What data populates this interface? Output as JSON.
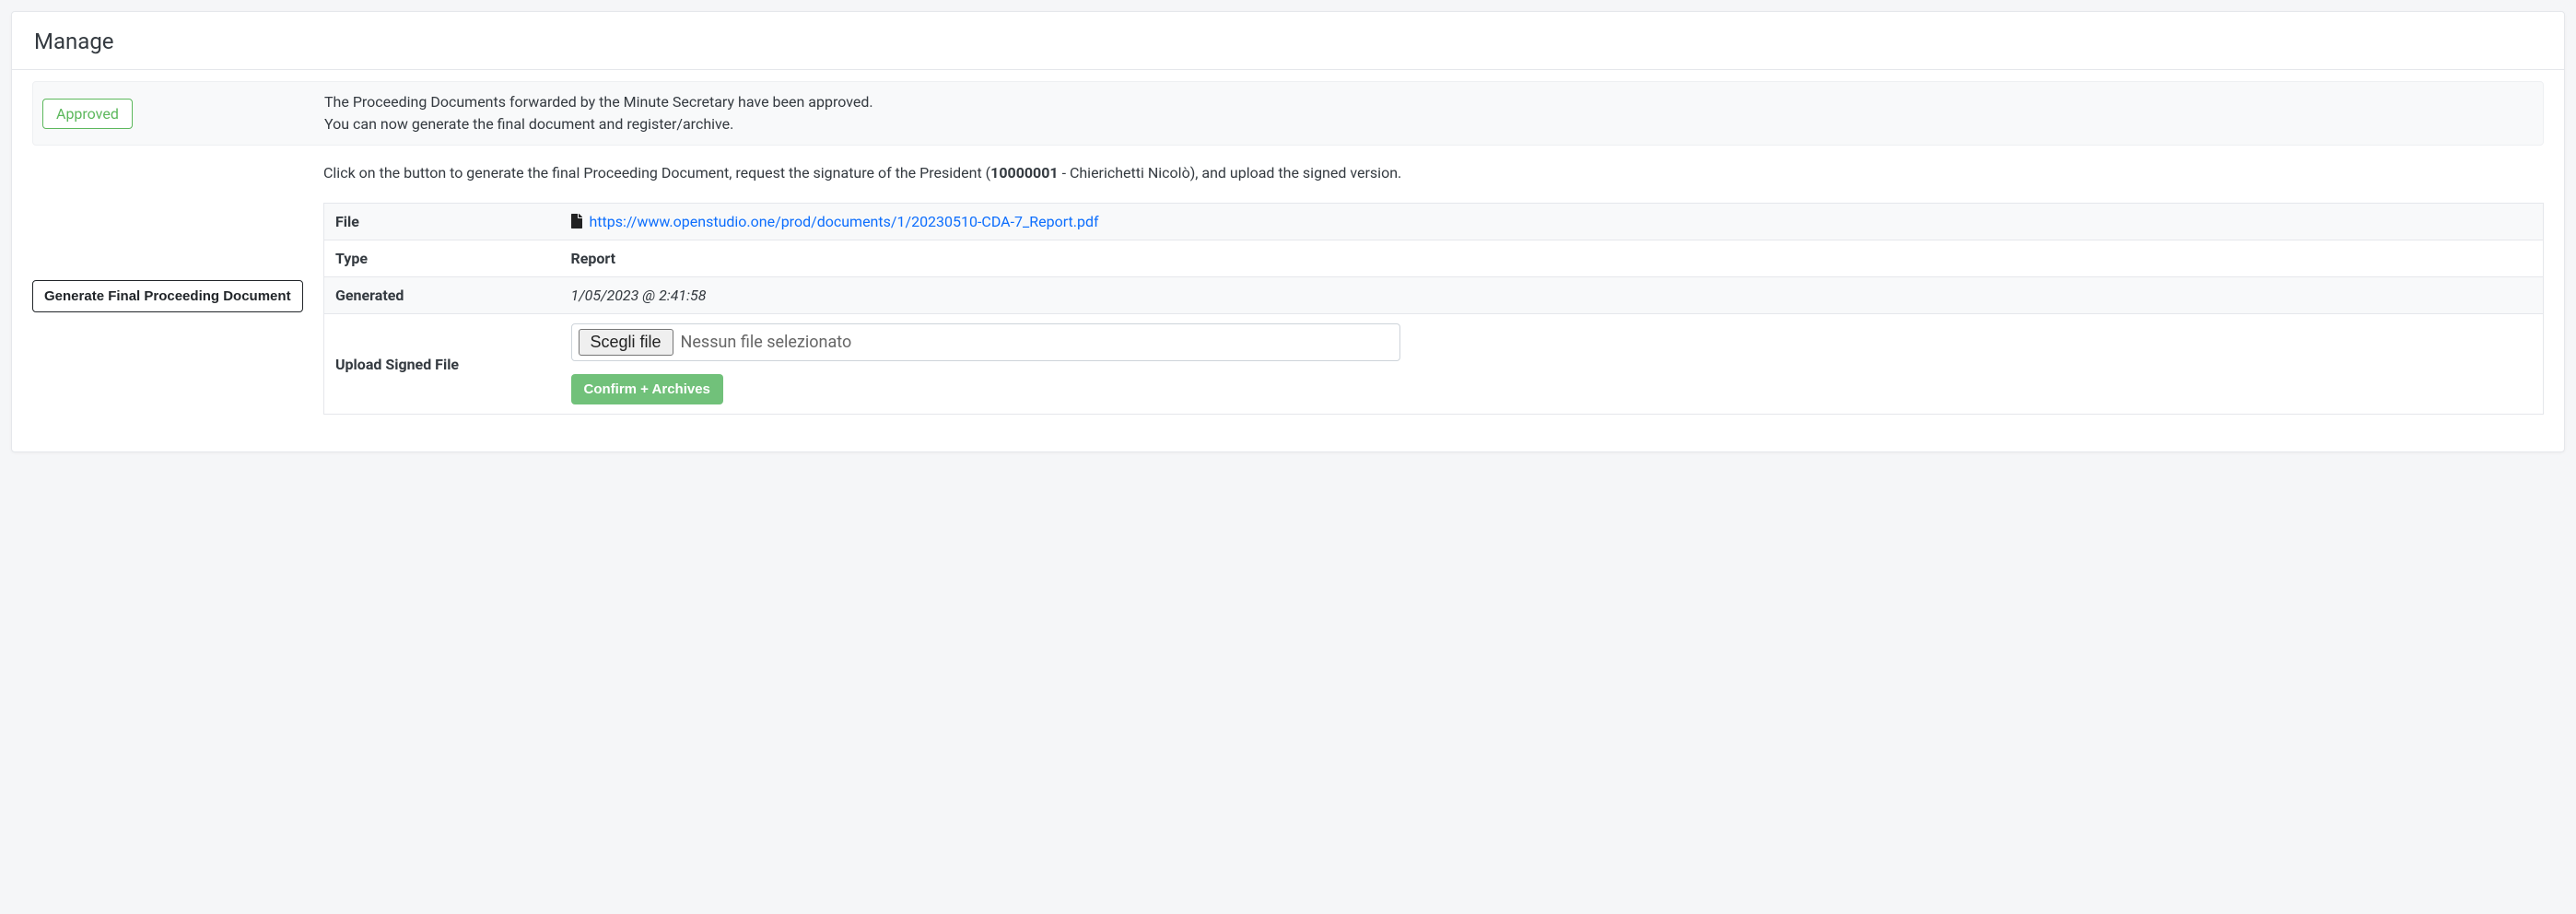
{
  "header": {
    "title": "Manage"
  },
  "status": {
    "badge": "Approved",
    "line1": "The Proceeding Documents forwarded by the Minute Secretary have been approved.",
    "line2": "You can now generate the final document and register/archive."
  },
  "instruction": {
    "prefix": "Click on the button to generate the final Proceeding Document, request the signature of the President (",
    "president_id": "10000001",
    "suffix": " - Chierichetti Nicolò), and upload the signed version."
  },
  "actions": {
    "generate_label": "Generate Final Proceeding Document",
    "choose_file_label": "Scegli file",
    "no_file_label": "Nessun file selezionato",
    "confirm_label": "Confirm + Archives"
  },
  "details": {
    "file_label": "File",
    "file_url": "https://www.openstudio.one/prod/documents/1/20230510-CDA-7_Report.pdf",
    "type_label": "Type",
    "type_value": "Report",
    "generated_label": "Generated",
    "generated_value": "1/05/2023 @ 2:41:58",
    "upload_label": "Upload Signed File"
  }
}
